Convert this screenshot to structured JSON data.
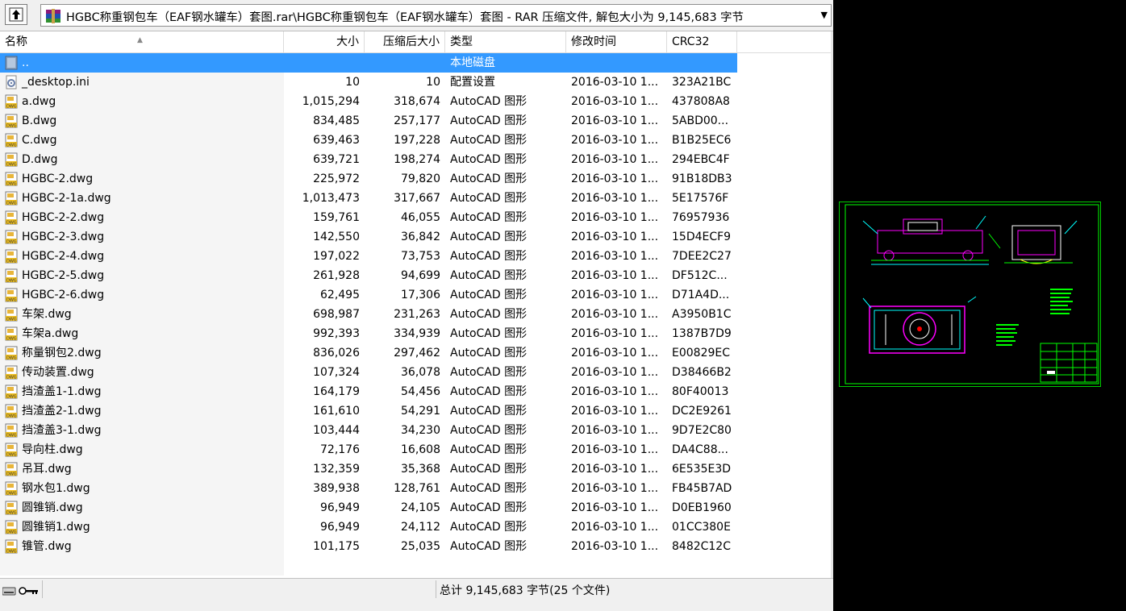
{
  "window": {
    "path": "HGBC称重钢包车（EAF钢水罐车）套图.rar\\HGBC称重钢包车（EAF钢水罐车）套图 - RAR 压缩文件, 解包大小为 9,145,683 字节"
  },
  "columns": {
    "name": "名称",
    "size": "大小",
    "packed": "压缩后大小",
    "type": "类型",
    "modified": "修改时间",
    "crc": "CRC32"
  },
  "files": [
    {
      "name": "..",
      "size": "",
      "packed": "",
      "type": "本地磁盘",
      "modified": "",
      "crc": "",
      "icon": "folder-up-icon"
    },
    {
      "name": "_desktop.ini",
      "size": "10",
      "packed": "10",
      "type": "配置设置",
      "modified": "2016-03-10 1...",
      "crc": "323A21BC",
      "icon": "settings-file-icon"
    },
    {
      "name": "a.dwg",
      "size": "1,015,294",
      "packed": "318,674",
      "type": "AutoCAD 图形",
      "modified": "2016-03-10 1...",
      "crc": "437808A8",
      "icon": "dwg-file-icon"
    },
    {
      "name": "B.dwg",
      "size": "834,485",
      "packed": "257,177",
      "type": "AutoCAD 图形",
      "modified": "2016-03-10 1...",
      "crc": "5ABD00...",
      "icon": "dwg-file-icon"
    },
    {
      "name": "C.dwg",
      "size": "639,463",
      "packed": "197,228",
      "type": "AutoCAD 图形",
      "modified": "2016-03-10 1...",
      "crc": "B1B25EC6",
      "icon": "dwg-file-icon"
    },
    {
      "name": "D.dwg",
      "size": "639,721",
      "packed": "198,274",
      "type": "AutoCAD 图形",
      "modified": "2016-03-10 1...",
      "crc": "294EBC4F",
      "icon": "dwg-file-icon"
    },
    {
      "name": "HGBC-2.dwg",
      "size": "225,972",
      "packed": "79,820",
      "type": "AutoCAD 图形",
      "modified": "2016-03-10 1...",
      "crc": "91B18DB3",
      "icon": "dwg-file-icon"
    },
    {
      "name": "HGBC-2-1a.dwg",
      "size": "1,013,473",
      "packed": "317,667",
      "type": "AutoCAD 图形",
      "modified": "2016-03-10 1...",
      "crc": "5E17576F",
      "icon": "dwg-file-icon"
    },
    {
      "name": "HGBC-2-2.dwg",
      "size": "159,761",
      "packed": "46,055",
      "type": "AutoCAD 图形",
      "modified": "2016-03-10 1...",
      "crc": "76957936",
      "icon": "dwg-file-icon"
    },
    {
      "name": "HGBC-2-3.dwg",
      "size": "142,550",
      "packed": "36,842",
      "type": "AutoCAD 图形",
      "modified": "2016-03-10 1...",
      "crc": "15D4ECF9",
      "icon": "dwg-file-icon"
    },
    {
      "name": "HGBC-2-4.dwg",
      "size": "197,022",
      "packed": "73,753",
      "type": "AutoCAD 图形",
      "modified": "2016-03-10 1...",
      "crc": "7DEE2C27",
      "icon": "dwg-file-icon"
    },
    {
      "name": "HGBC-2-5.dwg",
      "size": "261,928",
      "packed": "94,699",
      "type": "AutoCAD 图形",
      "modified": "2016-03-10 1...",
      "crc": "DF512C...",
      "icon": "dwg-file-icon"
    },
    {
      "name": "HGBC-2-6.dwg",
      "size": "62,495",
      "packed": "17,306",
      "type": "AutoCAD 图形",
      "modified": "2016-03-10 1...",
      "crc": "D71A4D...",
      "icon": "dwg-file-icon"
    },
    {
      "name": "车架.dwg",
      "size": "698,987",
      "packed": "231,263",
      "type": "AutoCAD 图形",
      "modified": "2016-03-10 1...",
      "crc": "A3950B1C",
      "icon": "dwg-file-icon"
    },
    {
      "name": "车架a.dwg",
      "size": "992,393",
      "packed": "334,939",
      "type": "AutoCAD 图形",
      "modified": "2016-03-10 1...",
      "crc": "1387B7D9",
      "icon": "dwg-file-icon"
    },
    {
      "name": "称量钢包2.dwg",
      "size": "836,026",
      "packed": "297,462",
      "type": "AutoCAD 图形",
      "modified": "2016-03-10 1...",
      "crc": "E00829EC",
      "icon": "dwg-file-icon"
    },
    {
      "name": "传动装置.dwg",
      "size": "107,324",
      "packed": "36,078",
      "type": "AutoCAD 图形",
      "modified": "2016-03-10 1...",
      "crc": "D38466B2",
      "icon": "dwg-file-icon"
    },
    {
      "name": "挡渣盖1-1.dwg",
      "size": "164,179",
      "packed": "54,456",
      "type": "AutoCAD 图形",
      "modified": "2016-03-10 1...",
      "crc": "80F40013",
      "icon": "dwg-file-icon"
    },
    {
      "name": "挡渣盖2-1.dwg",
      "size": "161,610",
      "packed": "54,291",
      "type": "AutoCAD 图形",
      "modified": "2016-03-10 1...",
      "crc": "DC2E9261",
      "icon": "dwg-file-icon"
    },
    {
      "name": "挡渣盖3-1.dwg",
      "size": "103,444",
      "packed": "34,230",
      "type": "AutoCAD 图形",
      "modified": "2016-03-10 1...",
      "crc": "9D7E2C80",
      "icon": "dwg-file-icon"
    },
    {
      "name": "导向柱.dwg",
      "size": "72,176",
      "packed": "16,608",
      "type": "AutoCAD 图形",
      "modified": "2016-03-10 1...",
      "crc": "DA4C88...",
      "icon": "dwg-file-icon"
    },
    {
      "name": "吊耳.dwg",
      "size": "132,359",
      "packed": "35,368",
      "type": "AutoCAD 图形",
      "modified": "2016-03-10 1...",
      "crc": "6E535E3D",
      "icon": "dwg-file-icon"
    },
    {
      "name": "钢水包1.dwg",
      "size": "389,938",
      "packed": "128,761",
      "type": "AutoCAD 图形",
      "modified": "2016-03-10 1...",
      "crc": "FB45B7AD",
      "icon": "dwg-file-icon"
    },
    {
      "name": "圆锥销.dwg",
      "size": "96,949",
      "packed": "24,105",
      "type": "AutoCAD 图形",
      "modified": "2016-03-10 1...",
      "crc": "D0EB1960",
      "icon": "dwg-file-icon"
    },
    {
      "name": "圆锥销1.dwg",
      "size": "96,949",
      "packed": "24,112",
      "type": "AutoCAD 图形",
      "modified": "2016-03-10 1...",
      "crc": "01CC380E",
      "icon": "dwg-file-icon"
    },
    {
      "name": "锥管.dwg",
      "size": "101,175",
      "packed": "25,035",
      "type": "AutoCAD 图形",
      "modified": "2016-03-10 1...",
      "crc": "8482C12C",
      "icon": "dwg-file-icon"
    }
  ],
  "status": {
    "total": "总计 9,145,683 字节(25 个文件)"
  },
  "colors": {
    "selection": "#3399ff",
    "cad_green": "#00ff00",
    "cad_magenta": "#ff00ff"
  }
}
